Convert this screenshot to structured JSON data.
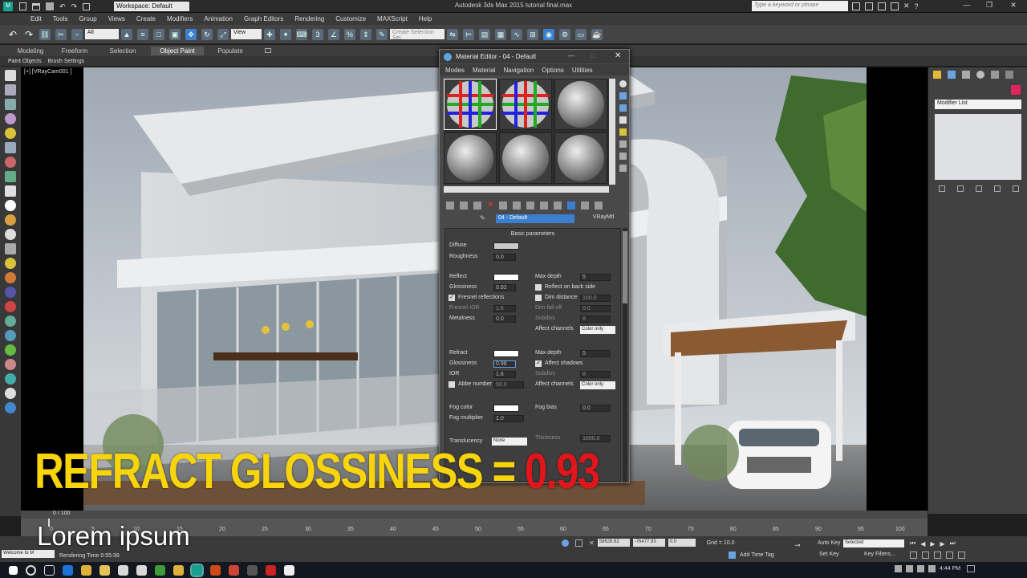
{
  "window": {
    "title": "Autodesk 3ds Max 2015     tutorial final.max",
    "workspace": "Workspace: Default",
    "search_placeholder": "Type a keyword or phrase"
  },
  "menubar": [
    "Edit",
    "Tools",
    "Group",
    "Views",
    "Create",
    "Modifiers",
    "Animation",
    "Graph Editors",
    "Rendering",
    "Customize",
    "MAXScript",
    "Help"
  ],
  "toolbar": {
    "filter": "All",
    "view": "View",
    "named_sel": "Create Selection Set"
  },
  "ribbon": {
    "tabs": [
      "Modeling",
      "Freeform",
      "Selection",
      "Object Paint",
      "Populate"
    ],
    "active": "Object Paint",
    "sub": [
      "Paint Objects",
      "Brush Settings"
    ]
  },
  "viewport": {
    "label": "[+] [VRayCam001 ]"
  },
  "right_panel": {
    "modifier_list": "Modifier List"
  },
  "material_editor": {
    "title": "Material Editor - 04 - Default",
    "menu": [
      "Modes",
      "Material",
      "Navigation",
      "Options",
      "Utilities"
    ],
    "material_name": "04 - Default",
    "material_type": "VRayMtl",
    "rollout": "Basic parameters",
    "diffuse": {
      "label": "Diffuse",
      "roughness_label": "Roughness",
      "roughness": "0.0"
    },
    "reflect": {
      "label": "Reflect",
      "glossiness_label": "Glossiness",
      "glossiness": "0.92",
      "fresnel": "Fresnel reflections",
      "fresnel_ior_label": "Fresnel IOR",
      "fresnel_ior": "1.6",
      "metalness_label": "Metalness",
      "metalness": "0.0",
      "max_depth_label": "Max depth",
      "max_depth": "5",
      "reflect_back": "Reflect on back side",
      "dim_distance_label": "Dim distance",
      "dim_distance": "100.0",
      "dim_falloff_label": "Dim fall off",
      "dim_falloff": "0.0",
      "subdivs_label": "Subdivs",
      "subdivs": "8",
      "affect_label": "Affect channels",
      "affect": "Color only"
    },
    "refract": {
      "label": "Refract",
      "glossiness_label": "Glossiness",
      "glossiness": "0.98",
      "ior_label": "IOR",
      "ior": "1.6",
      "abbe_label": "Abbe number",
      "abbe": "50.0",
      "max_depth_label": "Max depth",
      "max_depth": "5",
      "affect_shadows": "Affect shadows",
      "subdivs_label": "Subdivs",
      "subdivs": "8",
      "affect_label": "Affect channels",
      "affect": "Color only"
    },
    "fog": {
      "color_label": "Fog color",
      "mult_label": "Fog multiplier",
      "mult": "1.0",
      "bias_label": "Fog bias",
      "bias": "0.0"
    },
    "translucency": {
      "label": "Translucency",
      "value": "None",
      "thickness_label": "Thickness",
      "thickness": "1000.0"
    },
    "slots": 6
  },
  "caption": {
    "main": "REFRACT GLOSSINESS = ",
    "value": "0.93",
    "main_color": "#f7d40c",
    "value_color": "#e0161b"
  },
  "overlay": {
    "lorem": "Lorem ipsum"
  },
  "timeline": {
    "slider": "0 / 100",
    "ticks": [
      "0",
      "5",
      "10",
      "15",
      "20",
      "25",
      "30",
      "35",
      "40",
      "45",
      "50",
      "55",
      "60",
      "65",
      "70",
      "75",
      "80",
      "85",
      "90",
      "95",
      "100"
    ]
  },
  "status": {
    "maxscript": "Welcome to M",
    "render_time": "Rendering Time  0:55:38",
    "x": "58628.62",
    "y": "-76477.93",
    "z": "0.0",
    "grid": "Grid = 10.0",
    "auto_key": "Auto Key",
    "selected": "Selected",
    "set_key": "Set Key",
    "key_filters": "Key Filters...",
    "add_time_tag": "Add Time Tag"
  },
  "taskbar": {
    "clock": "4:44 PM"
  },
  "colors": {
    "window_bg": "#3a3a3a",
    "accent": "#1e73d8"
  }
}
